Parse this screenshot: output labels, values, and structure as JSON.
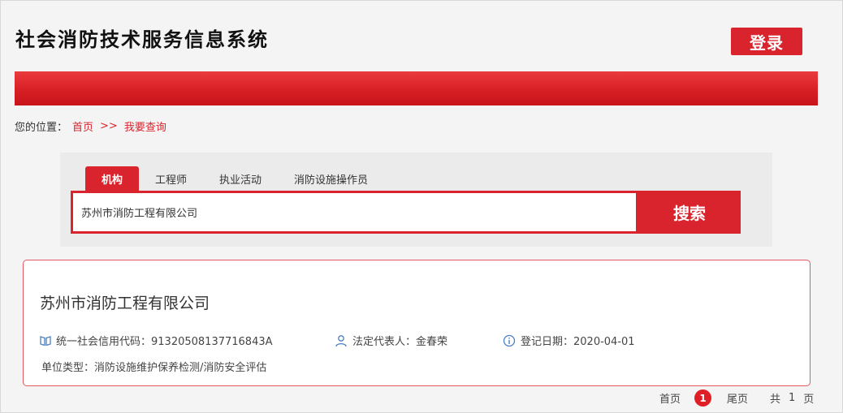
{
  "header": {
    "site_title": "社会消防技术服务信息系统",
    "login_label": "登录"
  },
  "breadcrumb": {
    "prefix": "您的位置：",
    "home": "首页",
    "separator": ">>",
    "current": "我要查询"
  },
  "search": {
    "tabs": [
      {
        "label": "机构",
        "active": true
      },
      {
        "label": "工程师",
        "active": false
      },
      {
        "label": "执业活动",
        "active": false
      },
      {
        "label": "消防设施操作员",
        "active": false
      }
    ],
    "query": "苏州市消防工程有限公司",
    "button_label": "搜索"
  },
  "result": {
    "name": "苏州市消防工程有限公司",
    "credit_code": "统一社会信用代码：91320508137716843A",
    "legal_rep": "法定代表人：金春荣",
    "reg_date": "登记日期：2020-04-01",
    "unit_type": "单位类型：消防设施维护保养检测/消防安全评估"
  },
  "pager": {
    "first": "首页",
    "current": "1",
    "last": "尾页",
    "total_prefix": "共",
    "total_pages": "1",
    "total_suffix": "页"
  },
  "colors": {
    "brand_red": "#d9242d",
    "icon_blue": "#4a7fc1"
  }
}
